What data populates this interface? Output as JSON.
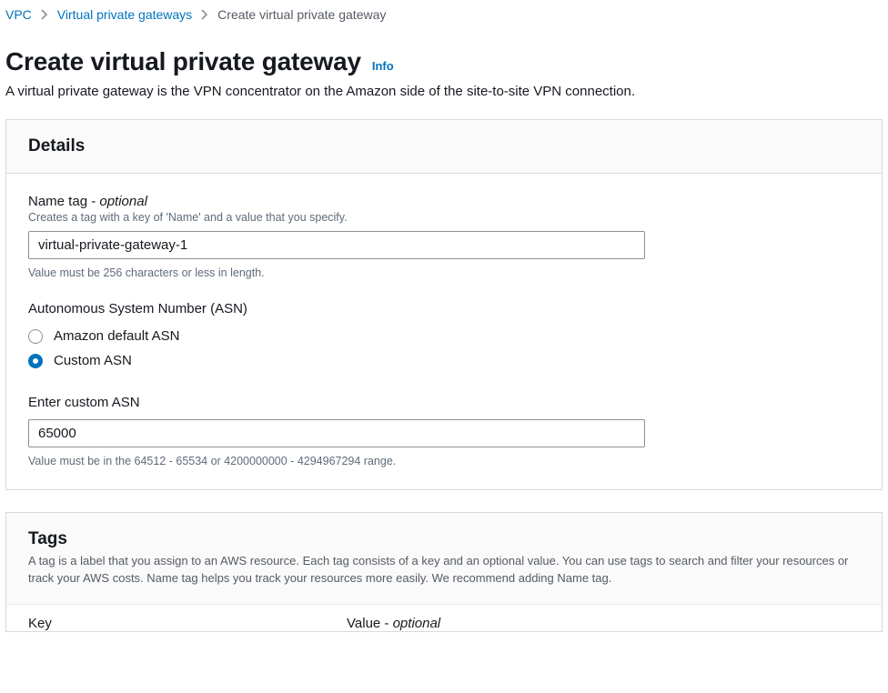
{
  "breadcrumbs": {
    "vpc": "VPC",
    "vpg": "Virtual private gateways",
    "current": "Create virtual private gateway"
  },
  "header": {
    "title": "Create virtual private gateway",
    "info": "Info",
    "description": "A virtual private gateway is the VPN concentrator on the Amazon side of the site-to-site VPN connection."
  },
  "details": {
    "panel_title": "Details",
    "name_tag": {
      "label_prefix": "Name tag - ",
      "label_optional": "optional",
      "help": "Creates a tag with a key of 'Name' and a value that you specify.",
      "value": "virtual-private-gateway-1",
      "constraint": "Value must be 256 characters or less in length."
    },
    "asn": {
      "label": "Autonomous System Number (ASN)",
      "option_default": "Amazon default ASN",
      "option_custom": "Custom ASN"
    },
    "custom_asn": {
      "label": "Enter custom ASN",
      "value": "65000",
      "constraint": "Value must be in the 64512 - 65534 or 4200000000 - 4294967294 range."
    }
  },
  "tags": {
    "panel_title": "Tags",
    "description": "A tag is a label that you assign to an AWS resource. Each tag consists of a key and an optional value. You can use tags to search and filter your resources or track your AWS costs. Name tag helps you track your resources more easily. We recommend adding Name tag.",
    "col_key": "Key",
    "col_value_prefix": "Value - ",
    "col_value_optional": "optional"
  }
}
